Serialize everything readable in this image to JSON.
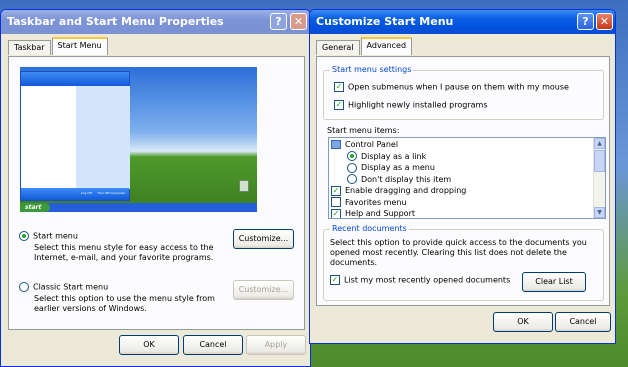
{
  "left_window": {
    "title": "Taskbar and Start Menu Properties",
    "tabs": [
      "Taskbar",
      "Start Menu"
    ],
    "preview": {
      "start_label": "start",
      "logoff": "Log Off",
      "turnoff": "Turn Off Computer"
    },
    "start_menu_option": {
      "label": "Start menu",
      "desc": "Select this menu style for easy access to the Internet, e-mail, and your favorite programs."
    },
    "classic_option": {
      "label": "Classic Start menu",
      "desc": "Select this option to use the menu style from earlier versions of Windows."
    },
    "customize_label": "Customize...",
    "customize_label2": "Customize...",
    "ok": "OK",
    "cancel": "Cancel",
    "apply": "Apply"
  },
  "right_window": {
    "title": "Customize Start Menu",
    "tabs": [
      "General",
      "Advanced"
    ],
    "settings_group": "Start menu settings",
    "settings": [
      "Open submenus when I pause on them with my mouse",
      "Highlight newly installed programs"
    ],
    "items_label": "Start menu items:",
    "items": [
      {
        "type": "icon",
        "label": "Control Panel"
      },
      {
        "type": "radio",
        "on": true,
        "label": "Display as a link"
      },
      {
        "type": "radio",
        "on": false,
        "label": "Display as a menu"
      },
      {
        "type": "radio",
        "on": false,
        "label": "Don't display this item"
      },
      {
        "type": "check",
        "on": true,
        "label": "Enable dragging and dropping"
      },
      {
        "type": "check",
        "on": false,
        "label": "Favorites menu"
      },
      {
        "type": "check",
        "on": true,
        "label": "Help and Support"
      }
    ],
    "recent_group": "Recent documents",
    "recent_desc": "Select this option to provide quick access to the documents you opened most recently.  Clearing this list does not delete the documents.",
    "recent_check": "List my most recently opened documents",
    "clear_list": "Clear List",
    "ok": "OK",
    "cancel": "Cancel"
  }
}
